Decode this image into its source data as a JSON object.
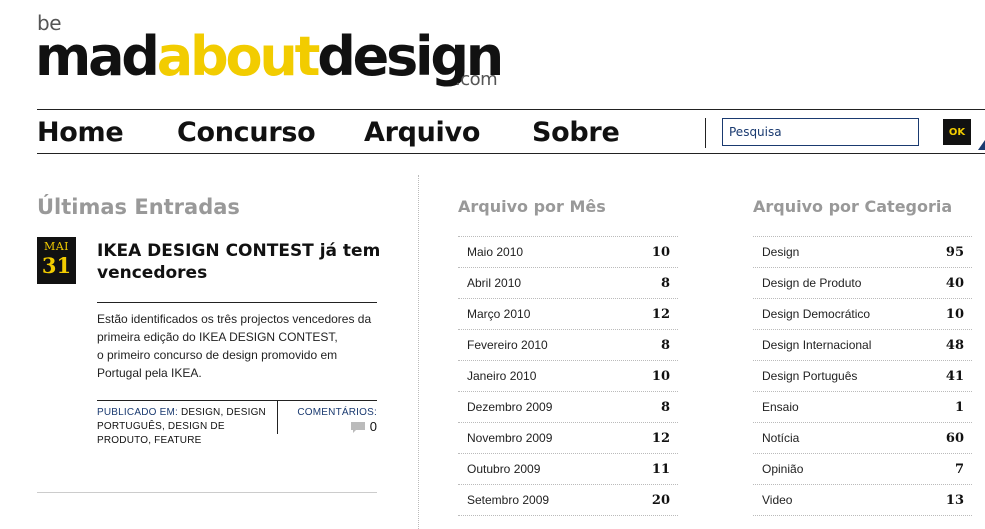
{
  "logo": {
    "be": "be",
    "part1": "mad",
    "part2": "about",
    "part3": "design",
    "com": ".com"
  },
  "nav": {
    "items": [
      {
        "label": "Home"
      },
      {
        "label": "Concurso"
      },
      {
        "label": "Arquivo"
      },
      {
        "label": "Sobre"
      }
    ],
    "search_placeholder": "Pesquisa",
    "ok_label": "OK"
  },
  "latest": {
    "title": "Últimas Entradas",
    "post": {
      "month": "MAI",
      "day": "31",
      "title": "IKEA DESIGN CONTEST já tem vencedores",
      "excerpt": [
        "Estão identificados os três projectos vencedores da",
        "primeira edição do IKEA DESIGN CONTEST,",
        "o primeiro concurso de design promovido em",
        "Portugal pela IKEA."
      ],
      "published_label": "PUBLICADO EM:",
      "published_value": "DESIGN, DESIGN PORTUGUÊS, DESIGN DE PRODUTO, FEATURE",
      "comments_label": "COMENTÁRIOS:",
      "comments_count": "0"
    }
  },
  "archive_month": {
    "title": "Arquivo por Mês",
    "items": [
      {
        "label": "Maio 2010",
        "count": "10"
      },
      {
        "label": "Abril 2010",
        "count": "8"
      },
      {
        "label": "Março 2010",
        "count": "12"
      },
      {
        "label": "Fevereiro 2010",
        "count": "8"
      },
      {
        "label": "Janeiro 2010",
        "count": "10"
      },
      {
        "label": "Dezembro 2009",
        "count": "8"
      },
      {
        "label": "Novembro 2009",
        "count": "12"
      },
      {
        "label": "Outubro 2009",
        "count": "11"
      },
      {
        "label": "Setembro 2009",
        "count": "20"
      }
    ]
  },
  "archive_category": {
    "title": "Arquivo por Categoria",
    "items": [
      {
        "label": "Design",
        "count": "95"
      },
      {
        "label": "Design de Produto",
        "count": "40"
      },
      {
        "label": "Design Democrático",
        "count": "10"
      },
      {
        "label": "Design Internacional",
        "count": "48"
      },
      {
        "label": "Design Português",
        "count": "41"
      },
      {
        "label": "Ensaio",
        "count": "1"
      },
      {
        "label": "Notícia",
        "count": "60"
      },
      {
        "label": "Opinião",
        "count": "7"
      },
      {
        "label": "Video",
        "count": "13"
      }
    ]
  },
  "colors": {
    "accent_yellow": "#f2cc00",
    "link_blue": "#1a3a70",
    "heading_gray": "#999999"
  }
}
